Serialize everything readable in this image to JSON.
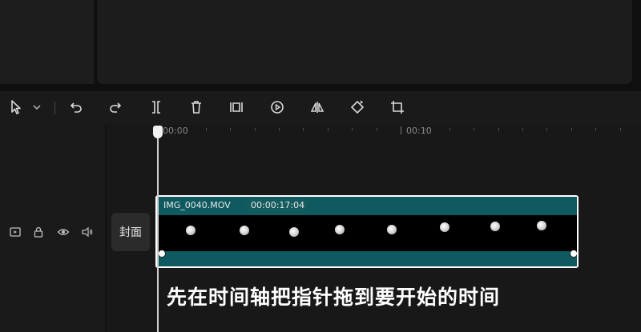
{
  "toolbar": {
    "tools": [
      "select-pointer",
      "undo",
      "redo",
      "split",
      "delete",
      "freeze-frame",
      "reverse",
      "mirror",
      "rotate",
      "crop"
    ]
  },
  "ruler": {
    "labels": [
      "00:00",
      "00:10"
    ]
  },
  "track": {
    "cover_label": "封面"
  },
  "clip": {
    "name": "IMG_0040.MOV",
    "duration": "00:00:17:04",
    "color": "#0f5a60"
  },
  "subtitle": "先在时间轴把指针拖到要开始的时间"
}
